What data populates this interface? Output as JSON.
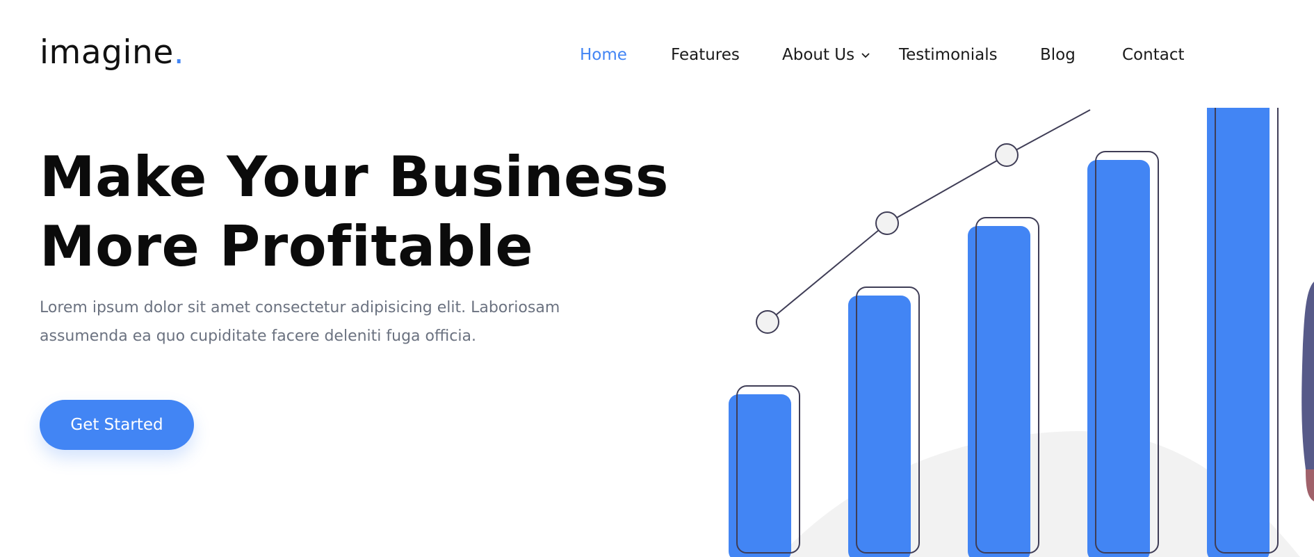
{
  "brand": {
    "name": "imagine",
    "dot": "."
  },
  "nav": {
    "items": [
      {
        "label": "Home",
        "active": true
      },
      {
        "label": "Features"
      },
      {
        "label": "About Us",
        "has_dropdown": true
      },
      {
        "label": "Testimonials"
      },
      {
        "label": "Blog"
      },
      {
        "label": "Contact"
      }
    ]
  },
  "hero": {
    "title_line1": "Make Your Business",
    "title_line2": "More Profitable",
    "description": "Lorem ipsum dolor sit amet consectetur adipisicing elit. Laboriosam assumenda ea quo cupiditate facere deleniti fuga officia.",
    "cta_label": "Get Started"
  },
  "colors": {
    "accent": "#4285f4",
    "text": "#0b0b0b",
    "muted": "#6b7280",
    "line": "#3f3d56"
  }
}
